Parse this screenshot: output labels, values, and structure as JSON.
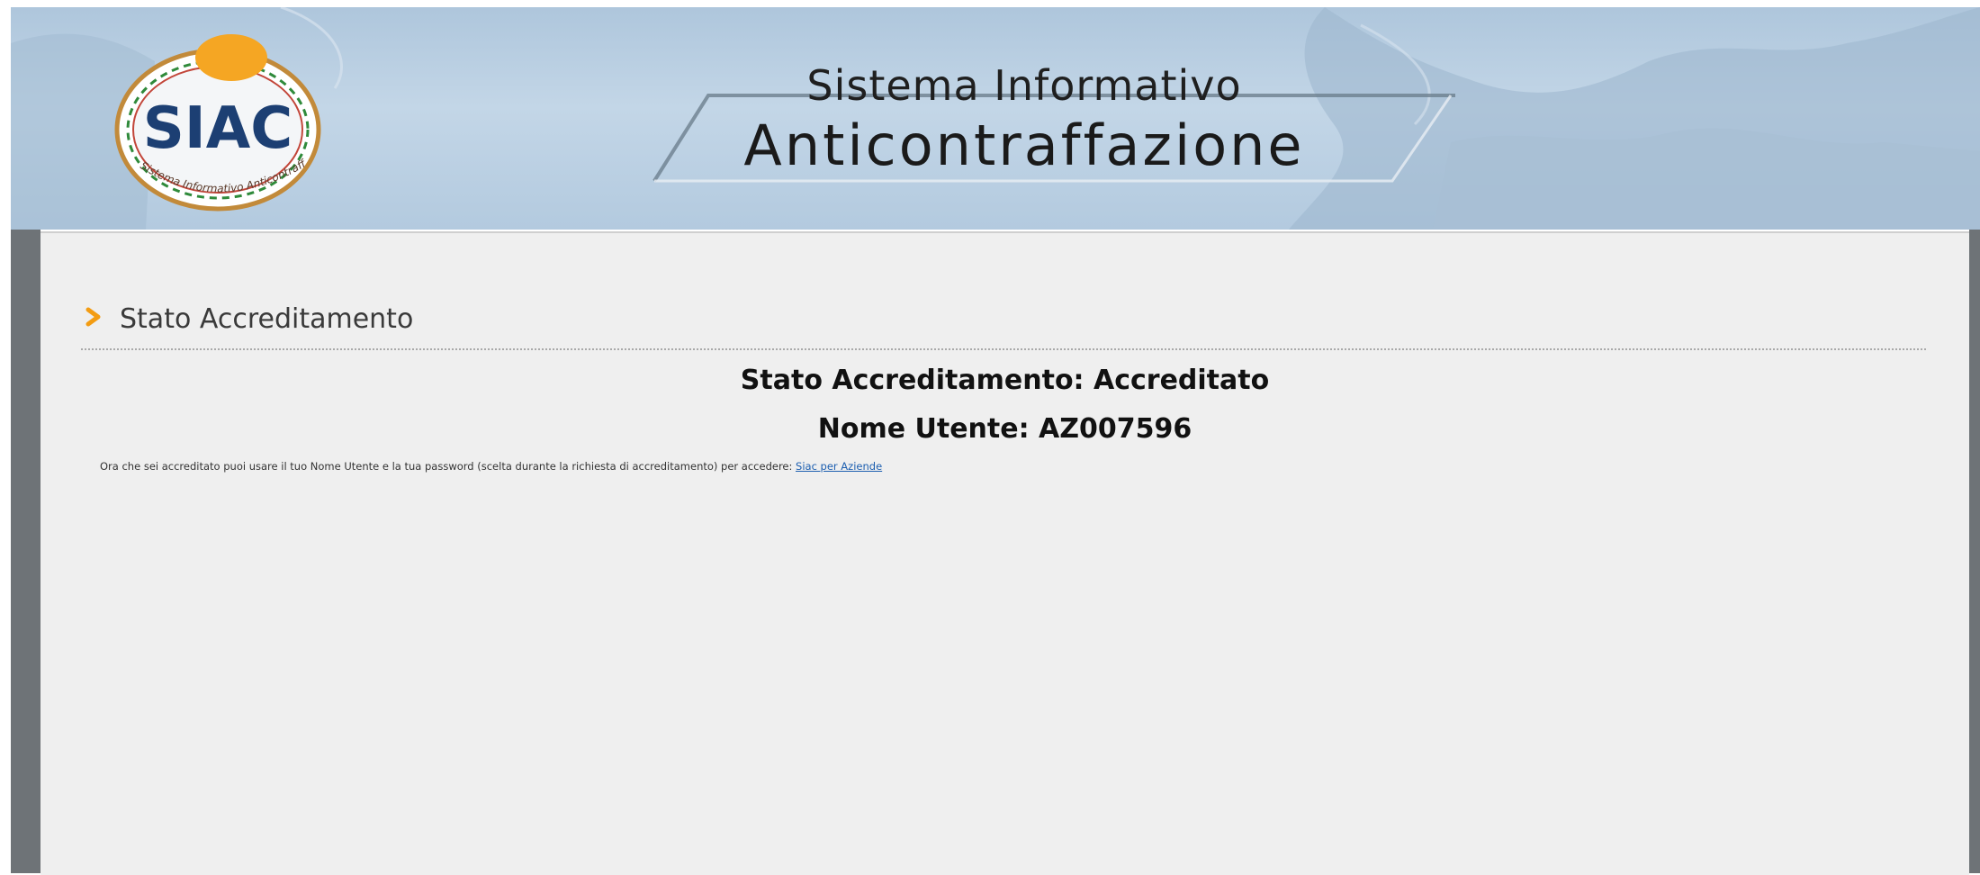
{
  "header": {
    "logo_text": "SIAC",
    "logo_ring_text": "Sistema Informativo Anticontraffazione",
    "title_line1": "Sistema Informativo",
    "title_line2": "Anticontraffazione"
  },
  "section": {
    "title": "Stato Accreditamento"
  },
  "status": {
    "accreditation": "Stato Accreditamento: Accreditato",
    "username": "Nome Utente: AZ007596"
  },
  "info": {
    "text": "Ora che sei accreditato puoi usare il tuo Nome Utente e la tua password (scelta durante la richiesta di accreditamento) per accedere: ",
    "link_label": "Siac per Aziende"
  },
  "colors": {
    "accent": "#f39c12",
    "banner": "#b8cde1",
    "content_bg": "#efefef",
    "frame": "#6e7377",
    "link": "#1d5fb0"
  }
}
